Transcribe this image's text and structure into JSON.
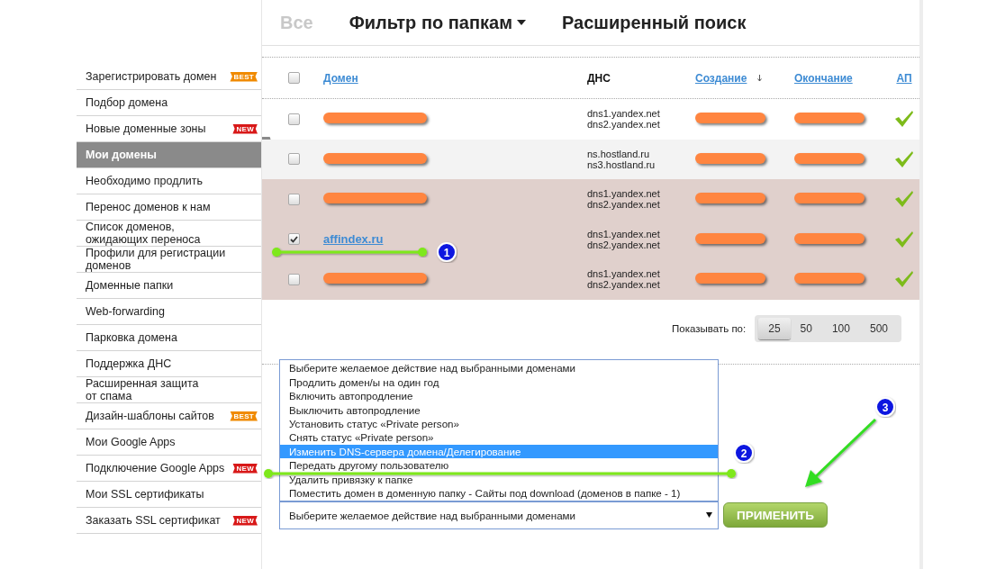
{
  "top_tabs": [
    {
      "label": "Все",
      "disabled": true,
      "kind": "text"
    },
    {
      "label": "Фильтр по папкам",
      "disabled": false,
      "kind": "dropdown"
    },
    {
      "label": "Расширенный поиск",
      "disabled": false,
      "kind": "text"
    }
  ],
  "sidebar": {
    "items": [
      {
        "label": "Зарегистрировать домен",
        "selected": false,
        "badge": {
          "text": "BEST",
          "kind": "best"
        }
      },
      {
        "label": "Подбор домена",
        "selected": false
      },
      {
        "label": "Новые доменные зоны",
        "selected": false,
        "badge": {
          "text": "NEW",
          "kind": "new"
        }
      },
      {
        "label": "Мои домены",
        "selected": true
      },
      {
        "label": "Необходимо продлить",
        "selected": false
      },
      {
        "label": "Перенос доменов к нам",
        "selected": false
      },
      {
        "label": "Список доменов,\nожидающих переноса",
        "selected": false
      },
      {
        "label": "Профили для регистрации\nдоменов",
        "selected": false
      },
      {
        "label": "Доменные папки",
        "selected": false
      },
      {
        "label": "Web-forwarding",
        "selected": false
      },
      {
        "label": "Парковка домена",
        "selected": false
      },
      {
        "label": "Поддержка ДНС",
        "selected": false
      },
      {
        "label": "Расширенная защита\nот спама",
        "selected": false
      },
      {
        "label": "Дизайн-шаблоны сайтов",
        "selected": false,
        "badge": {
          "text": "BEST",
          "kind": "best"
        }
      },
      {
        "label": "Мои Google Apps",
        "selected": false
      },
      {
        "label": "Подключение Google Apps",
        "selected": false,
        "badge": {
          "text": "NEW",
          "kind": "new"
        }
      },
      {
        "label": "Мои SSL сертификаты",
        "selected": false
      },
      {
        "label": "Заказать SSL сертификат",
        "selected": false,
        "badge": {
          "text": "NEW",
          "kind": "new"
        }
      }
    ]
  },
  "table": {
    "select_all": {
      "checked": false
    },
    "columns": [
      {
        "label": "Домен",
        "kind": "link",
        "sorted": false
      },
      {
        "label": "ДНС",
        "kind": "plain",
        "sorted": false
      },
      {
        "label": "Создание",
        "kind": "link",
        "sorted": true
      },
      {
        "label": "Окончание",
        "kind": "link",
        "sorted": false
      },
      {
        "label": "АП",
        "kind": "link",
        "sorted": false
      }
    ],
    "rows": [
      {
        "checked": false,
        "hovered": false,
        "highlighted": false,
        "domain": {
          "redacted": true
        },
        "dns": [
          "dns1.yandex.net",
          "dns2.yandex.net"
        ],
        "created": {
          "redacted": true
        },
        "expires": {
          "redacted": true
        },
        "autorenew": true
      },
      {
        "checked": false,
        "hovered": true,
        "highlighted": false,
        "domain": {
          "redacted": true
        },
        "dns": [
          "ns.hostland.ru",
          "ns3.hostland.ru"
        ],
        "created": {
          "redacted": true
        },
        "expires": {
          "redacted": true
        },
        "autorenew": true
      },
      {
        "checked": false,
        "hovered": false,
        "highlighted": true,
        "domain": {
          "redacted": true
        },
        "dns": [
          "dns1.yandex.net",
          "dns2.yandex.net"
        ],
        "created": {
          "redacted": true
        },
        "expires": {
          "redacted": true
        },
        "autorenew": true
      },
      {
        "checked": true,
        "hovered": false,
        "highlighted": true,
        "domain": {
          "redacted": false,
          "text": "affindex.ru"
        },
        "dns": [
          "dns1.yandex.net",
          "dns2.yandex.net"
        ],
        "created": {
          "redacted": true
        },
        "expires": {
          "redacted": true
        },
        "autorenew": true
      },
      {
        "checked": false,
        "hovered": false,
        "highlighted": true,
        "domain": {
          "redacted": true
        },
        "dns": [
          "dns1.yandex.net",
          "dns2.yandex.net"
        ],
        "created": {
          "redacted": true
        },
        "expires": {
          "redacted": true
        },
        "autorenew": true
      }
    ]
  },
  "pagination": {
    "label": "Показывать по:",
    "options": [
      {
        "label": "25",
        "selected": true
      },
      {
        "label": "50",
        "selected": false
      },
      {
        "label": "100",
        "selected": false
      },
      {
        "label": "500",
        "selected": false
      }
    ]
  },
  "action": {
    "options": [
      {
        "label": "Выберите желаемое действие над выбранными доменами",
        "highlighted": false
      },
      {
        "label": "Продлить домен/ы на один год",
        "highlighted": false
      },
      {
        "label": "Включить автопродление",
        "highlighted": false
      },
      {
        "label": "Выключить автопродление",
        "highlighted": false
      },
      {
        "label": "Установить статус «Private person»",
        "highlighted": false
      },
      {
        "label": "Снять статус «Private person»",
        "highlighted": false
      },
      {
        "label": "Изменить DNS-сервера домена/Делегирование",
        "highlighted": true
      },
      {
        "label": "Передать другому пользователю",
        "highlighted": false
      },
      {
        "label": "Удалить привязку к папке",
        "highlighted": false
      },
      {
        "label": "Поместить домен в доменную папку - Сайты под download (доменов в папке - 1)",
        "highlighted": false
      }
    ],
    "value": "Выберите желаемое действие над выбранными доменами",
    "button": "ПРИМЕНИТЬ"
  },
  "annotations": [
    {
      "number": "1"
    },
    {
      "number": "2"
    },
    {
      "number": "3"
    }
  ]
}
